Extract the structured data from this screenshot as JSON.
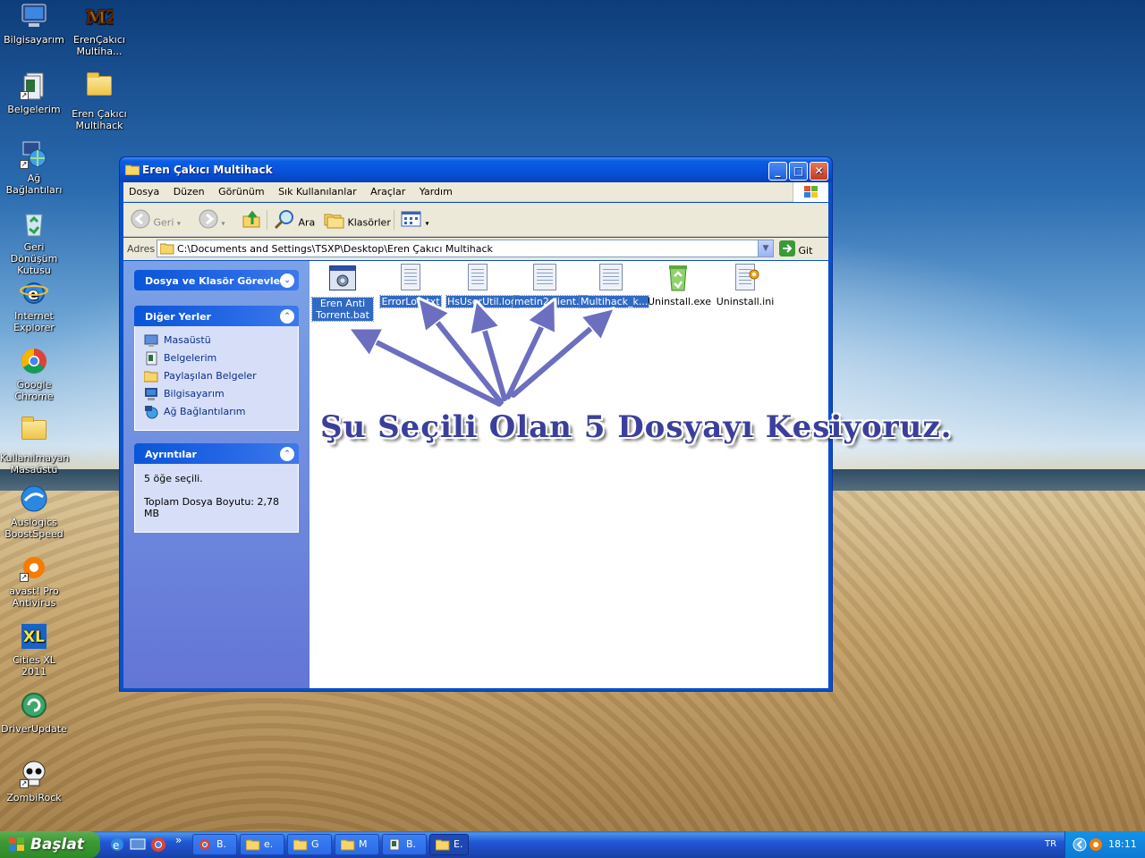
{
  "desktop": {
    "icons": [
      {
        "label": "Bilgisayarım",
        "icon": "my-computer-icon"
      },
      {
        "label": "ErenÇakıcı Multiha...",
        "icon": "metin2-icon"
      },
      {
        "label": "Belgelerim",
        "icon": "my-documents-icon"
      },
      {
        "label": "Eren Çakıcı Multihack",
        "icon": "folder-icon"
      },
      {
        "label": "Ağ Bağlantıları",
        "icon": "network-connections-icon"
      },
      {
        "label": "Geri Dönüşüm Kutusu",
        "icon": "recycle-bin-icon"
      },
      {
        "label": "Internet Explorer",
        "icon": "internet-explorer-icon"
      },
      {
        "label": "Google Chrome",
        "icon": "chrome-icon"
      },
      {
        "label": "Kullanılmayan Masaüstü",
        "icon": "folder-icon"
      },
      {
        "label": "Auslogics BoostSpeed",
        "icon": "boostspeed-icon"
      },
      {
        "label": "avast! Pro Antivirus",
        "icon": "avast-icon"
      },
      {
        "label": "Cities XL 2011",
        "icon": "cities-xl-icon"
      },
      {
        "label": "DriverUpdate",
        "icon": "driverupdate-icon"
      },
      {
        "label": "ZombiRock",
        "icon": "skull-icon"
      }
    ]
  },
  "window": {
    "title": "Eren Çakıcı Multihack",
    "menu": [
      "Dosya",
      "Düzen",
      "Görünüm",
      "Sık Kullanılanlar",
      "Araçlar",
      "Yardım"
    ],
    "toolbar": {
      "back_label": "Geri",
      "search_label": "Ara",
      "folders_label": "Klasörler"
    },
    "address": {
      "label": "Adres",
      "path": "C:\\Documents and Settings\\TSXP\\Desktop\\Eren Çakıcı Multihack",
      "go_label": "Git"
    },
    "sidebar": {
      "tasks_title": "Dosya ve Klasör Görevleri",
      "other_places_title": "Diğer Yerler",
      "other_places": [
        {
          "label": "Masaüstü",
          "icon": "desktop-icon"
        },
        {
          "label": "Belgelerim",
          "icon": "my-documents-icon"
        },
        {
          "label": "Paylaşılan Belgeler",
          "icon": "folder-icon"
        },
        {
          "label": "Bilgisayarım",
          "icon": "my-computer-icon"
        },
        {
          "label": "Ağ Bağlantılarım",
          "icon": "network-icon"
        }
      ],
      "details_title": "Ayrıntılar",
      "details_selected": "5 öğe seçili.",
      "details_size": "Toplam Dosya Boyutu: 2,78 MB"
    },
    "files": [
      {
        "name": "Eren Anti Torrent.bat",
        "selected": true,
        "icon": "batch-file-icon"
      },
      {
        "name": "ErrorLog.txt",
        "selected": true,
        "icon": "text-file-icon"
      },
      {
        "name": "HsUserUtil.log",
        "selected": true,
        "icon": "log-file-icon"
      },
      {
        "name": "metin2client...",
        "selected": true,
        "icon": "app-window-icon"
      },
      {
        "name": "Multihack_k...",
        "selected": true,
        "icon": "app-window-icon"
      },
      {
        "name": "Uninstall.exe",
        "selected": false,
        "icon": "recycle-uninstall-icon"
      },
      {
        "name": "Uninstall.ini",
        "selected": false,
        "icon": "ini-file-icon"
      }
    ]
  },
  "annotation": {
    "text": "Şu Seçili Olan 5 Dosyayı Kesiyoruz."
  },
  "taskbar": {
    "start_label": "Başlat",
    "tasks": [
      {
        "label": "B.",
        "icon": "chrome-icon",
        "active": false
      },
      {
        "label": "e.",
        "icon": "folder-icon",
        "active": false
      },
      {
        "label": "G",
        "icon": "folder-icon",
        "active": false
      },
      {
        "label": "M",
        "icon": "folder-icon",
        "active": false
      },
      {
        "label": "B.",
        "icon": "notepad-icon",
        "active": false
      },
      {
        "label": "E.",
        "icon": "folder-icon",
        "active": true
      }
    ],
    "overflow": "»",
    "language": "TR",
    "clock": "18:11"
  },
  "colors": {
    "selection": "#316ac5",
    "annotation_text": "#3b3f9c",
    "arrow": "#6c6fbf"
  }
}
